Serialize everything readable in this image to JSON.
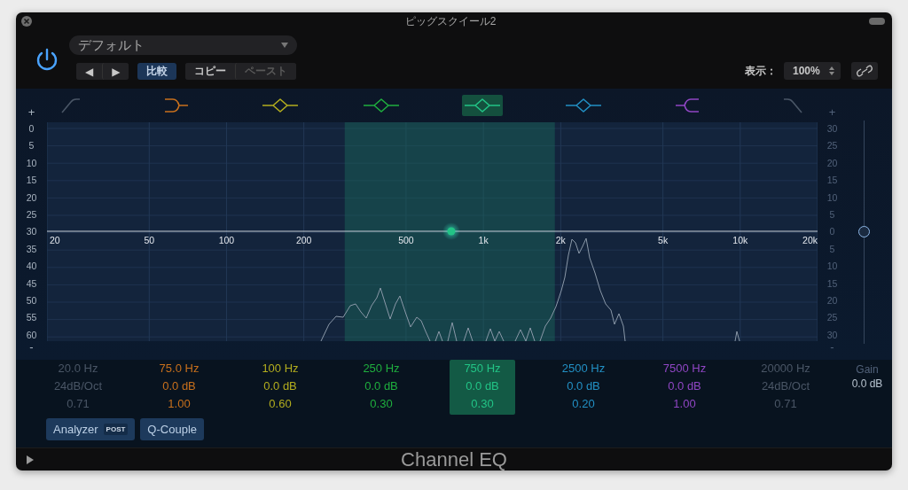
{
  "window": {
    "title": "ピッグスクイール2"
  },
  "header": {
    "preset": "デフォルト",
    "nav_buttons": [
      "◀",
      "▶"
    ],
    "compare": {
      "label": "比較",
      "on": true
    },
    "copy": {
      "label": "コピー",
      "disabled": false
    },
    "paste": {
      "label": "ペースト",
      "disabled": true
    },
    "view_label": "表示：",
    "zoom": "100%"
  },
  "eq": {
    "left_scale": {
      "increase": "+",
      "decrease": "-",
      "labels": [
        "0",
        "5",
        "10",
        "15",
        "20",
        "25",
        "30",
        "35",
        "40",
        "45",
        "50",
        "55",
        "60"
      ]
    },
    "right_scale": {
      "increase": "+",
      "decrease": "-",
      "labels": [
        "30",
        "25",
        "20",
        "15",
        "10",
        "5",
        "0",
        "5",
        "10",
        "15",
        "20",
        "25",
        "30"
      ]
    },
    "frequency_labels": [
      "20",
      "50",
      "100",
      "200",
      "500",
      "1k",
      "2k",
      "5k",
      "10k",
      "20k"
    ],
    "gain": {
      "label": "Gain",
      "value": "0.0 dB",
      "level": 0.5
    }
  },
  "bands": [
    {
      "kind": "lowcut",
      "on": false,
      "selected": false,
      "frequency": "20.0 Hz",
      "slope": "24dB/Oct",
      "q": "0.71"
    },
    {
      "kind": "lowshelf",
      "on": true,
      "selected": false,
      "color": "#c8701c",
      "frequency": "75.0 Hz",
      "gain": "0.0 dB",
      "q": "1.00"
    },
    {
      "kind": "bell",
      "on": true,
      "selected": false,
      "color": "#b3ad1e",
      "frequency": "100 Hz",
      "gain": "0.0 dB",
      "q": "0.60"
    },
    {
      "kind": "bell",
      "on": true,
      "selected": false,
      "color": "#1fae3e",
      "frequency": "250 Hz",
      "gain": "0.0 dB",
      "q": "0.30"
    },
    {
      "kind": "bell",
      "on": true,
      "selected": true,
      "color": "#22c486",
      "frequency": "750 Hz",
      "gain": "0.0 dB",
      "q": "0.30"
    },
    {
      "kind": "bell",
      "on": true,
      "selected": false,
      "color": "#2290c4",
      "frequency": "2500 Hz",
      "gain": "0.0 dB",
      "q": "0.20"
    },
    {
      "kind": "highshelf",
      "on": true,
      "selected": false,
      "color": "#9046c4",
      "frequency": "7500 Hz",
      "gain": "0.0 dB",
      "q": "1.00"
    },
    {
      "kind": "highcut",
      "on": false,
      "selected": false,
      "frequency": "20000 Hz",
      "slope": "24dB/Oct",
      "q": "0.71"
    }
  ],
  "buttons": {
    "analyzer": {
      "label": "Analyzer",
      "badge": "POST"
    },
    "q_couple": "Q-Couple"
  },
  "footer": {
    "title": "Channel EQ"
  }
}
